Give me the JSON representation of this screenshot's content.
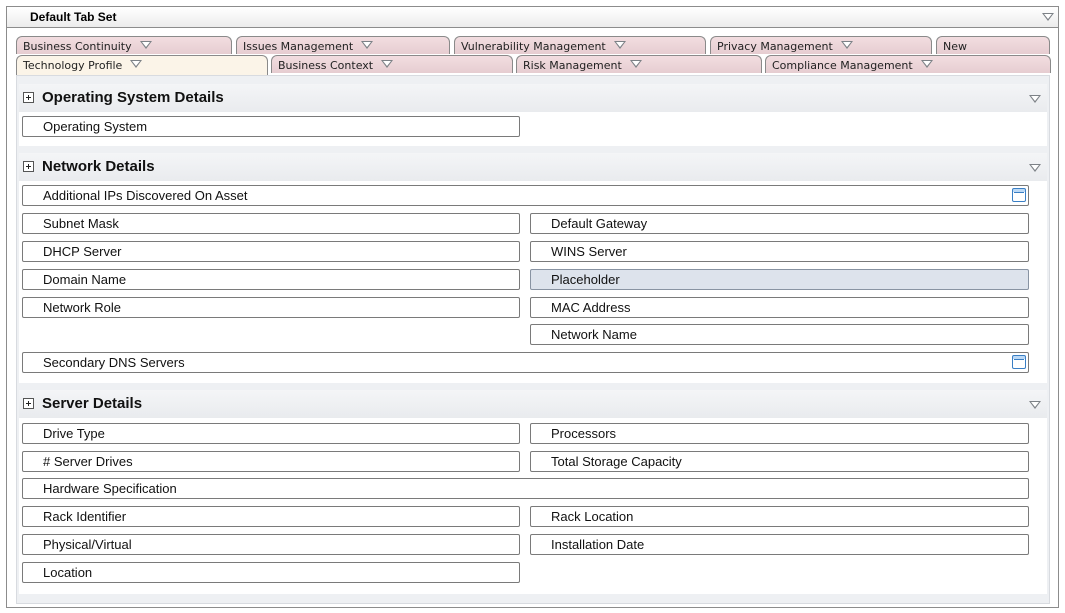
{
  "header": {
    "title": "Default Tab Set"
  },
  "tabs_row1": [
    {
      "label": "Business Continuity"
    },
    {
      "label": "Issues Management"
    },
    {
      "label": "Vulnerability Management"
    },
    {
      "label": "Privacy Management"
    },
    {
      "label": "New"
    }
  ],
  "tabs_row2": [
    {
      "label": "Technology Profile",
      "active": true
    },
    {
      "label": "Business Context"
    },
    {
      "label": "Risk Management"
    },
    {
      "label": "Compliance Management"
    }
  ],
  "sections": {
    "os": {
      "title": "Operating System Details",
      "fields": {
        "operating_system": "Operating System"
      }
    },
    "network": {
      "title": "Network Details",
      "fields": {
        "additional_ips": "Additional IPs Discovered On Asset",
        "subnet_mask": "Subnet Mask",
        "default_gateway": "Default Gateway",
        "dhcp_server": "DHCP Server",
        "wins_server": "WINS Server",
        "domain_name": "Domain Name",
        "placeholder": "Placeholder",
        "network_role": "Network Role",
        "mac_address": "MAC Address",
        "network_name": "Network Name",
        "secondary_dns": "Secondary DNS Servers"
      }
    },
    "server": {
      "title": "Server Details",
      "fields": {
        "drive_type": "Drive Type",
        "processors": "Processors",
        "server_drives": "# Server Drives",
        "total_storage": "Total Storage Capacity",
        "hardware_spec": "Hardware Specification",
        "rack_identifier": "Rack Identifier",
        "rack_location": "Rack Location",
        "physical_virtual": "Physical/Virtual",
        "installation_date": "Installation Date",
        "location": "Location"
      }
    }
  },
  "icons": {
    "collapse": "chevron-down-icon",
    "expand": "plus-box-icon",
    "picker": "calendar-icon"
  },
  "colors": {
    "tab_background": "#e6cdd1",
    "active_tab_background": "#fbf4e8",
    "highlight_field": "#dde3ec",
    "panel_background": "#eef0f3"
  }
}
